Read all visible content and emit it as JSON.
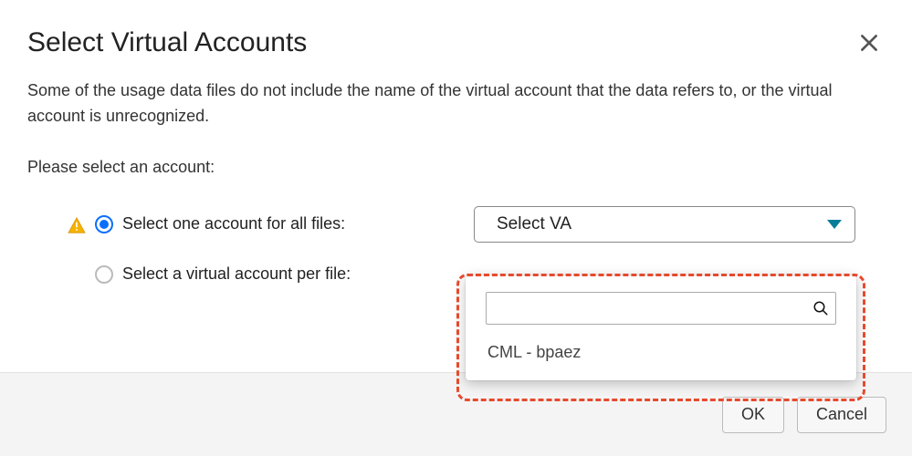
{
  "dialog": {
    "title": "Select Virtual Accounts",
    "description": "Some of the usage data files do not include the name of the virtual account that the data refers to, or the virtual account is unrecognized.",
    "prompt": "Please select an account:",
    "options": {
      "all_files": {
        "label": "Select one account for all files:",
        "selected": true,
        "warning": true
      },
      "per_file": {
        "label": "Select a virtual account per file:",
        "selected": false,
        "warning": false
      }
    },
    "select": {
      "placeholder": "Select VA",
      "search_value": "",
      "items": [
        "CML - bpaez"
      ]
    },
    "buttons": {
      "ok": "OK",
      "cancel": "Cancel"
    }
  }
}
